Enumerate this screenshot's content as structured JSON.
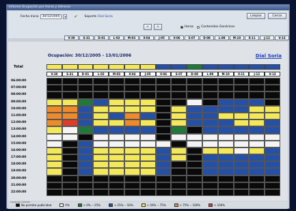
{
  "window": {
    "title": "Informe Ocupación por Horas y Géneros"
  },
  "filters": {
    "date_label": "Fecha Inicio",
    "date_value": "30/12/2005",
    "operator_label": "Soporte",
    "operator_value": "Dial Soria",
    "nav_prev": "<",
    "nav_next": ">",
    "radio_horas": "Horas",
    "radio_generos": "Contenidos Genéricos",
    "btn_limpiar": "Limpiar",
    "btn_cerrar": "Cerrar"
  },
  "tabs": [
    "V-30",
    "S-31",
    "D-01",
    "L-02",
    "M-03",
    "X-04",
    "J-05",
    "V-06",
    "S-07",
    "D-08",
    "L-09",
    "M-10",
    "X-11",
    "J-12",
    "V-13"
  ],
  "report": {
    "title": "Ocupación: 30/12/2005 - 13/01/2006",
    "operator": "Dial Soria",
    "total_label": "Total"
  },
  "days": [
    "V-30",
    "S-31",
    "D-01",
    "L-02",
    "M-03",
    "X-04",
    "J-05",
    "V-06",
    "S-07",
    "D-08",
    "L-09",
    "M-10",
    "X-11",
    "J-12",
    "V-13"
  ],
  "hours": [
    "06:00:00",
    "07:00:00",
    "08:00:00",
    "09:00:00",
    "10:00:00",
    "11:00:00",
    "12:00:00",
    "13:00:00",
    "14:00:00",
    "15:00:00",
    "16:00:00",
    "17:00:00",
    "18:00:00",
    "19:00:00",
    "20:00:00",
    "21:00:00",
    "22:00:00"
  ],
  "colors": {
    "K": "#0a0a0a",
    "W": "#f4f4f4",
    "G": "#1f7a3a",
    "B": "#2450a8",
    "Y": "#f2e85a",
    "O": "#ef8a2a",
    "R": "#e23a2a"
  },
  "total_row": "YYYYYYYBBGBBBBB",
  "grid_rows": [
    "KKKKKKKKKKKKKKK",
    "KKKKKKKKKKKKKKK",
    "KKKKKKKKKKKKKKK",
    "YYGBYYYKKWKBBBK",
    "OOBYYYYKYBBBBYY",
    "OOBYBOBKYBBYYYY",
    "ORBYYOYKYBBBYYB",
    "YWGBBBBKGKBBBBB",
    "WWKWWWWKWWWWWWW",
    "WKBWWWWWKWWWWWW",
    "YKBYYYYBYKYYWYB",
    "YKBYYYYBYKBBBBB",
    "YKBYYYYBKKBBBBB",
    "YKBYYYYBKKBBBBB",
    "KKKKKKKKKKKKKKK",
    "KKKKKKKKKKKKKKK",
    "KKKKKKKKKKKKKKK"
  ],
  "legend": {
    "title": "Leyenda Colores",
    "items": [
      {
        "color": "#0a0a0a",
        "label": "No permite publicidad"
      },
      {
        "color": "#f4f4f4",
        "label": "0%"
      },
      {
        "color": "#1f7a3a",
        "label": "> 0% -- 25%"
      },
      {
        "color": "#2450a8",
        "label": "> 25% -- 50%"
      },
      {
        "color": "#f2e85a",
        "label": "> 50% -- 75%"
      },
      {
        "color": "#ef8a2a",
        "label": "> 75% -- 100%"
      },
      {
        "color": "#e23a2a",
        "label": "> 100%"
      }
    ]
  }
}
